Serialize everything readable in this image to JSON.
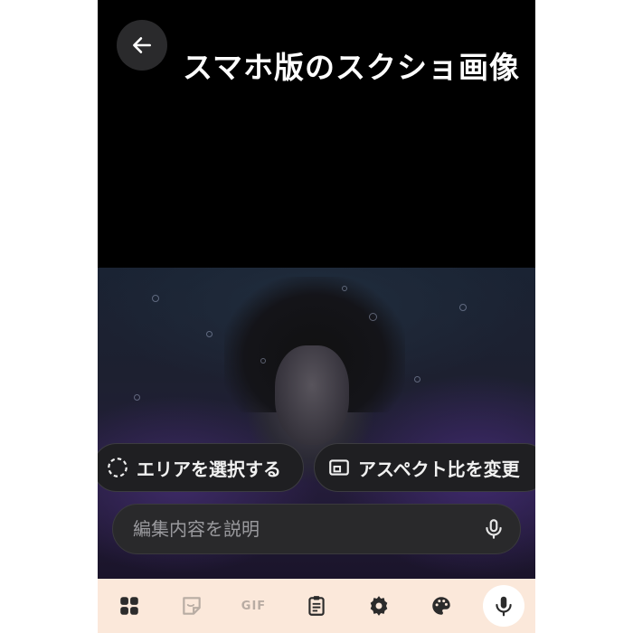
{
  "caption": "スマホ版のスクショ画像",
  "actions": {
    "select_area_label": "エリアを選択する",
    "aspect_label": "アスペクト比を変更"
  },
  "prompt_input": {
    "placeholder": "編集内容を説明",
    "value": ""
  },
  "keyboard_toolbar": {
    "items": [
      "apps-icon",
      "sticker-icon",
      "GIF",
      "clipboard-icon",
      "settings-icon",
      "palette-icon",
      "microphone-icon"
    ],
    "gif_label": "GIF"
  },
  "colors": {
    "background": "#000000",
    "chip_bg": "#1f1f22",
    "input_bg": "#29292b",
    "toolbar_bg": "#fbe8da",
    "icon_dark": "#2b2b2b"
  }
}
